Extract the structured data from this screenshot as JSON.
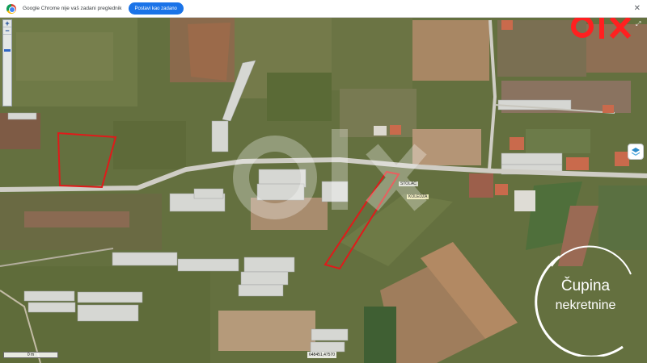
{
  "infobar": {
    "message": "Google Chrome nije vaš zadani preglednik",
    "set_default_label": "Postavi kao zadano",
    "close_icon": "close-icon"
  },
  "watermark": {
    "brand": "OLX",
    "brand_color": "#ff2020"
  },
  "map": {
    "type": "satellite",
    "zoom_in_label": "+",
    "zoom_out_label": "−",
    "layer_icon": "layers-icon",
    "scale_text": "0 m",
    "coordinates_text": "648451,47570",
    "labels": [
      "STOLAC",
      "KOLEDŽA"
    ],
    "parcel_outline_color": "#e01a1a"
  },
  "agency": {
    "name_line1": "Čupina",
    "name_line2": "nekretnine"
  }
}
